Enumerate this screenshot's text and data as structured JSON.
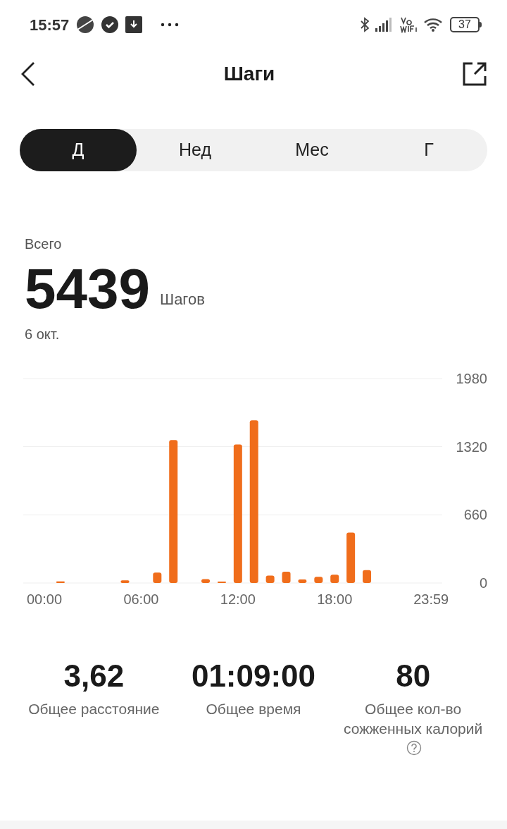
{
  "status_bar": {
    "time": "15:57",
    "battery": "37"
  },
  "header": {
    "title": "Шаги"
  },
  "tabs": [
    {
      "label": "Д",
      "selected": true
    },
    {
      "label": "Нед",
      "selected": false
    },
    {
      "label": "Мес",
      "selected": false
    },
    {
      "label": "Г",
      "selected": false
    }
  ],
  "summary": {
    "label": "Всего",
    "value": "5439",
    "unit": "Шагов",
    "date": "6 окт."
  },
  "chart_data": {
    "type": "bar",
    "x": [
      1,
      5,
      7,
      8,
      10,
      11,
      12,
      13,
      14,
      15,
      16,
      17,
      18,
      19,
      20
    ],
    "series": [
      {
        "color": "#f06d1b",
        "values": [
          15,
          25,
          100,
          1385,
          38,
          13,
          1341,
          1576,
          72,
          110,
          34,
          60,
          81,
          489,
          125
        ]
      }
    ],
    "xlim": [
      -1.31,
      24.67
    ],
    "ylim": [
      0,
      1980
    ],
    "yticks": [
      0,
      660,
      1320,
      1980
    ],
    "xticks": [
      {
        "value": 0,
        "label": "00:00"
      },
      {
        "value": 6,
        "label": "06:00"
      },
      {
        "value": 12,
        "label": "12:00"
      },
      {
        "value": 18,
        "label": "18:00"
      },
      {
        "value": 23.98,
        "label": "23:59"
      }
    ]
  },
  "stats": [
    {
      "value": "3,62",
      "label": "Общее расстояние",
      "help": false
    },
    {
      "value": "01:09:00",
      "label": "Общее время",
      "help": false
    },
    {
      "value": "80",
      "label": "Общее кол-во сожженных калорий",
      "help": true
    }
  ]
}
